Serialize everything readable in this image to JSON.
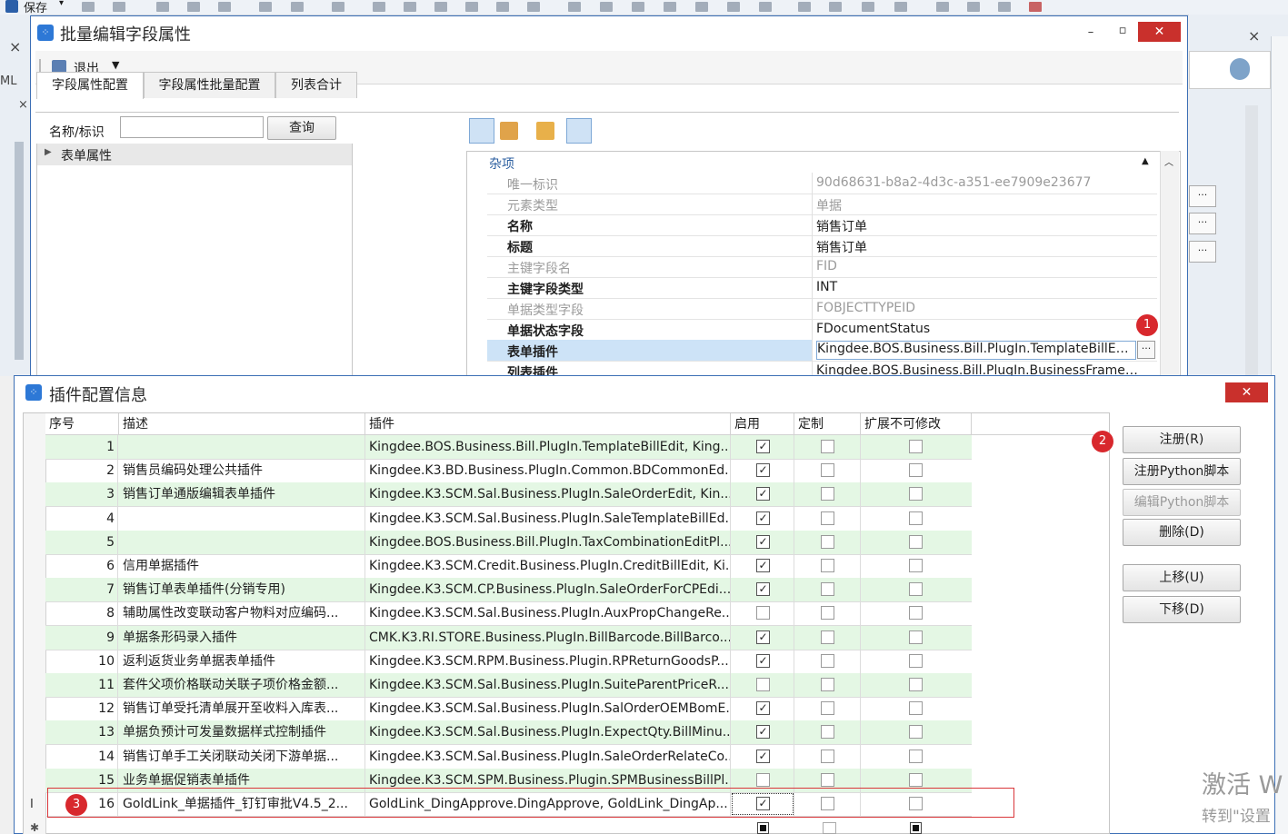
{
  "app_toolbar": {
    "save_label": "保存"
  },
  "batch_window": {
    "title": "批量编辑字段属性",
    "exit_label": "退出",
    "tabs": [
      "字段属性配置",
      "字段属性批量配置",
      "列表合计"
    ],
    "search_label": "名称/标识",
    "search_value": "",
    "query_button": "查询",
    "tree_root": "表单属性",
    "category": "杂项",
    "properties": [
      {
        "key": "唯一标识",
        "value": "90d68631-b8a2-4d3c-a351-ee7909e23677",
        "style": "gray"
      },
      {
        "key": "元素类型",
        "value": "单据",
        "style": "gray"
      },
      {
        "key": "名称",
        "value": "销售订单",
        "style": "bold"
      },
      {
        "key": "标题",
        "value": "销售订单",
        "style": "bold"
      },
      {
        "key": "主键字段名",
        "value": "FID",
        "style": "gray"
      },
      {
        "key": "主键字段类型",
        "value": "INT",
        "style": "bold"
      },
      {
        "key": "单据类型字段",
        "value": "FOBJECTTYPEID",
        "style": "gray"
      },
      {
        "key": "单据状态字段",
        "value": "FDocumentStatus",
        "style": "bold"
      },
      {
        "key": "表单插件",
        "value": "Kingdee.BOS.Business.Bill.PlugIn.TemplateBillEdit,...",
        "style": "bold"
      },
      {
        "key": "列表插件",
        "value": "Kingdee.BOS.Business.Bill.PlugIn.BusinessFrameWor...",
        "style": "bold"
      }
    ]
  },
  "plugin_window": {
    "title": "插件配置信息",
    "columns": [
      "序号",
      "描述",
      "插件",
      "启用",
      "定制",
      "扩展不可修改"
    ],
    "rows": [
      {
        "no": "1",
        "desc": "",
        "plugin": "Kingdee.BOS.Business.Bill.PlugIn.TemplateBillEdit, King...",
        "enabled": true
      },
      {
        "no": "2",
        "desc": "销售员编码处理公共插件",
        "plugin": "Kingdee.K3.BD.Business.PlugIn.Common.BDCommonEd...",
        "enabled": true
      },
      {
        "no": "3",
        "desc": "销售订单通版编辑表单插件",
        "plugin": "Kingdee.K3.SCM.Sal.Business.PlugIn.SaleOrderEdit, Kin...",
        "enabled": true
      },
      {
        "no": "4",
        "desc": "",
        "plugin": "Kingdee.K3.SCM.Sal.Business.PlugIn.SaleTemplateBillEd...",
        "enabled": true
      },
      {
        "no": "5",
        "desc": "",
        "plugin": " Kingdee.BOS.Business.Bill.PlugIn.TaxCombinationEditPl...",
        "enabled": true
      },
      {
        "no": "6",
        "desc": "信用单据插件",
        "plugin": "Kingdee.K3.SCM.Credit.Business.PlugIn.CreditBillEdit, Ki...",
        "enabled": true
      },
      {
        "no": "7",
        "desc": "销售订单表单插件(分销专用)",
        "plugin": "Kingdee.K3.SCM.CP.Business.PlugIn.SaleOrderForCPEdi...",
        "enabled": true
      },
      {
        "no": "8",
        "desc": "辅助属性改变联动客户物料对应编码...",
        "plugin": "Kingdee.K3.SCM.Sal.Business.PlugIn.AuxPropChangeRe...",
        "enabled": false
      },
      {
        "no": "9",
        "desc": "单据条形码录入插件",
        "plugin": "CMK.K3.RI.STORE.Business.PlugIn.BillBarcode.BillBarco...",
        "enabled": true
      },
      {
        "no": "10",
        "desc": "返利返货业务单据表单插件",
        "plugin": "Kingdee.K3.SCM.RPM.Business.Plugin.RPReturnGoodsP...",
        "enabled": true
      },
      {
        "no": "11",
        "desc": "套件父项价格联动关联子项价格金额...",
        "plugin": "Kingdee.K3.SCM.Sal.Business.PlugIn.SuiteParentPriceR...",
        "enabled": false
      },
      {
        "no": "12",
        "desc": "销售订单受托清单展开至收料入库表...",
        "plugin": "Kingdee.K3.SCM.Sal.Business.PlugIn.SalOrderOEMBomE...",
        "enabled": true
      },
      {
        "no": "13",
        "desc": "单据负预计可发量数据样式控制插件",
        "plugin": "Kingdee.K3.SCM.Sal.Business.PlugIn.ExpectQty.BillMinu...",
        "enabled": true
      },
      {
        "no": "14",
        "desc": "销售订单手工关闭联动关闭下游单据...",
        "plugin": "Kingdee.K3.SCM.Sal.Business.PlugIn.SaleOrderRelateCo...",
        "enabled": true
      },
      {
        "no": "15",
        "desc": "业务单据促销表单插件",
        "plugin": "Kingdee.K3.SCM.SPM.Business.Plugin.SPMBusinessBillPl...",
        "enabled": false
      },
      {
        "no": "16",
        "desc": "GoldLink_单据插件_钉钉审批V4.5_2...",
        "plugin": "GoldLink_DingApprove.DingApprove, GoldLink_DingAp...",
        "enabled": true
      }
    ],
    "buttons": [
      "注册(R)",
      "注册Python脚本",
      "编辑Python脚本",
      "删除(D)",
      "上移(U)",
      "下移(D)"
    ],
    "row_marker": "I"
  },
  "badges": [
    "1",
    "2",
    "3"
  ],
  "watermark": {
    "line1": "激活 W",
    "line2": "转到\"设置"
  },
  "colors": {
    "accent": "#2d78d6",
    "close": "#c9302c",
    "row_green": "#e4f7e4",
    "badge": "#d8282d",
    "highlight": "#cde3f7"
  }
}
